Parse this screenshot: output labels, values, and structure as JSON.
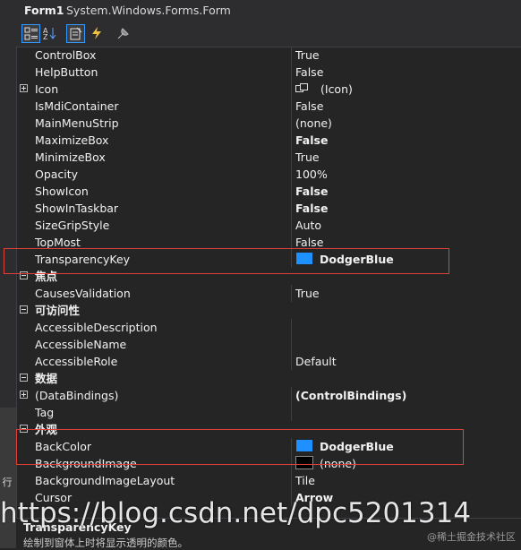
{
  "header": {
    "name": "Form1",
    "type": "System.Windows.Forms.Form"
  },
  "toolbar": {
    "buttons": [
      {
        "name": "categorized-icon",
        "active": true
      },
      {
        "name": "alphabetical-icon",
        "active": false
      },
      {
        "name": "properties-icon",
        "active": true
      },
      {
        "name": "events-icon",
        "active": false
      },
      {
        "name": "property-pages-icon",
        "active": false
      }
    ]
  },
  "left_edge": {
    "hint": "行"
  },
  "rows": [
    {
      "kind": "prop",
      "name": "ControlBox",
      "value": "True"
    },
    {
      "kind": "prop",
      "name": "HelpButton",
      "value": "False"
    },
    {
      "kind": "prop",
      "name": "Icon",
      "value": "(Icon)",
      "expand": "plus",
      "icon": "form-icon"
    },
    {
      "kind": "prop",
      "name": "IsMdiContainer",
      "value": "False"
    },
    {
      "kind": "prop",
      "name": "MainMenuStrip",
      "value": "(none)"
    },
    {
      "kind": "prop",
      "name": "MaximizeBox",
      "value": "False",
      "bold": true
    },
    {
      "kind": "prop",
      "name": "MinimizeBox",
      "value": "True"
    },
    {
      "kind": "prop",
      "name": "Opacity",
      "value": "100%"
    },
    {
      "kind": "prop",
      "name": "ShowIcon",
      "value": "False",
      "bold": true
    },
    {
      "kind": "prop",
      "name": "ShowInTaskbar",
      "value": "False",
      "bold": true
    },
    {
      "kind": "prop",
      "name": "SizeGripStyle",
      "value": "Auto"
    },
    {
      "kind": "prop",
      "name": "TopMost",
      "value": "False"
    },
    {
      "kind": "prop",
      "name": "TransparencyKey",
      "value": "DodgerBlue",
      "bold": true,
      "swatch": "#1e90ff"
    },
    {
      "kind": "cat",
      "name": "焦点"
    },
    {
      "kind": "prop",
      "name": "CausesValidation",
      "value": "True"
    },
    {
      "kind": "cat",
      "name": "可访问性"
    },
    {
      "kind": "prop",
      "name": "AccessibleDescription",
      "value": ""
    },
    {
      "kind": "prop",
      "name": "AccessibleName",
      "value": ""
    },
    {
      "kind": "prop",
      "name": "AccessibleRole",
      "value": "Default"
    },
    {
      "kind": "cat",
      "name": "数据"
    },
    {
      "kind": "prop",
      "name": "(DataBindings)",
      "value": "(ControlBindings)",
      "bold": true,
      "expand": "plus"
    },
    {
      "kind": "prop",
      "name": "Tag",
      "value": ""
    },
    {
      "kind": "cat",
      "name": "外观"
    },
    {
      "kind": "prop",
      "name": "BackColor",
      "value": "DodgerBlue",
      "bold": true,
      "swatch": "#1e90ff"
    },
    {
      "kind": "prop",
      "name": "BackgroundImage",
      "value": "(none)",
      "swatch": "#000000"
    },
    {
      "kind": "prop",
      "name": "BackgroundImageLayout",
      "value": "Tile"
    },
    {
      "kind": "prop",
      "name": "Cursor",
      "value": "Arrow",
      "bold": true
    }
  ],
  "description": {
    "name": "TransparencyKey",
    "text": "绘制到窗体上时将显示透明的颜色。"
  },
  "watermark": {
    "url": "https://blog.csdn.net/dpc5201314",
    "credit": "@稀土掘金技术社区"
  },
  "colors": {
    "highlight": "#e0403a",
    "background": "#252526",
    "accent": "#3399ff"
  }
}
